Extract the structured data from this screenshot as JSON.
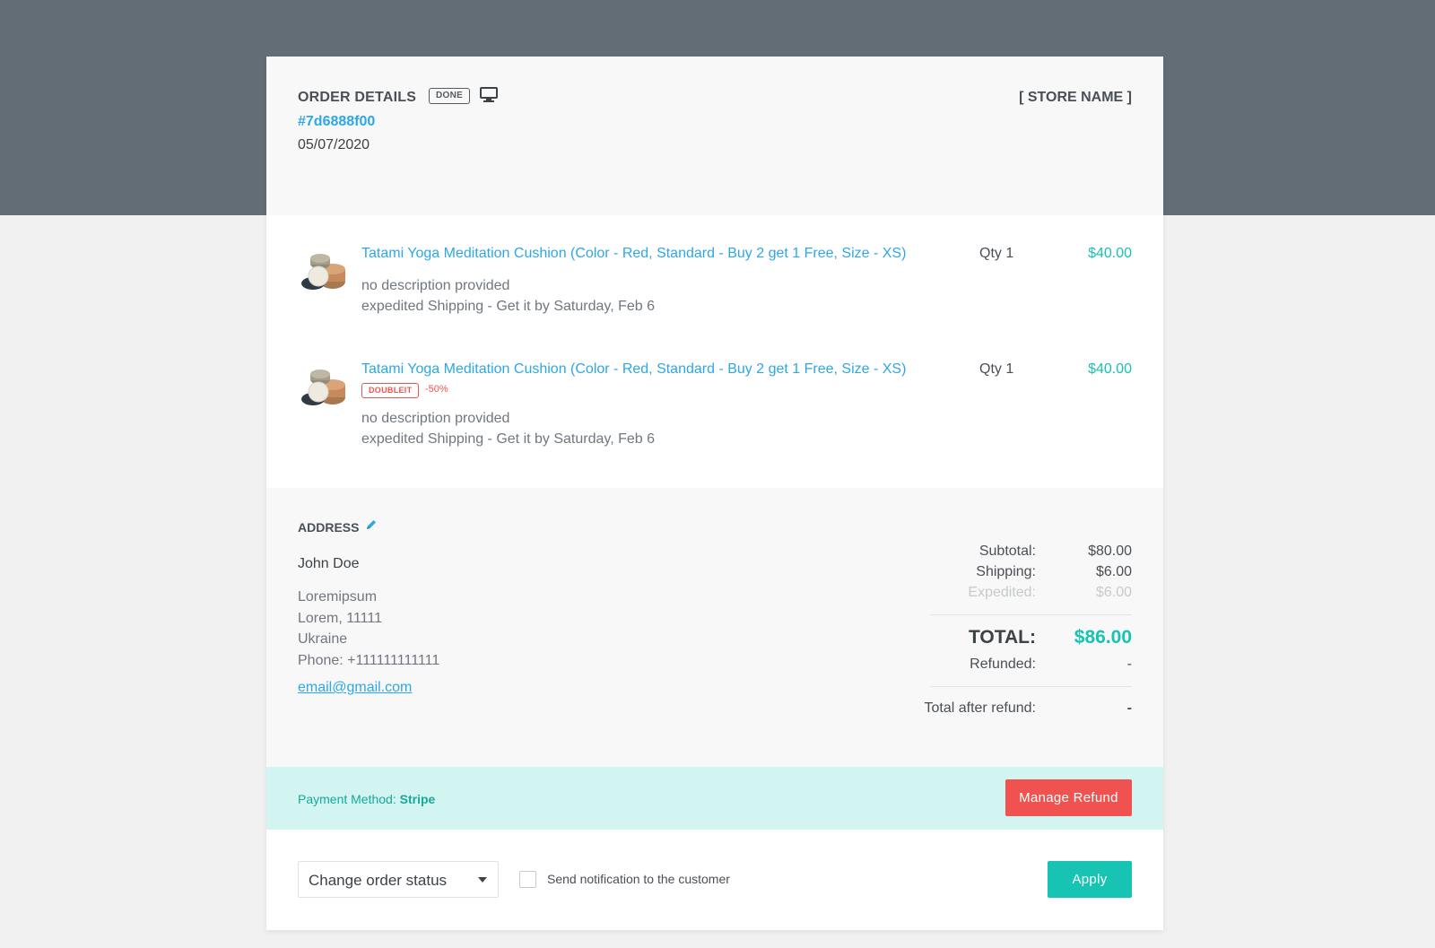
{
  "header": {
    "title": "ORDER DETAILS",
    "status_badge": "DONE",
    "order_id": "#7d6888f00",
    "date": "05/07/2020",
    "store_name": "[ STORE NAME ]"
  },
  "products": [
    {
      "name": "Tatami Yoga Meditation Cushion (Color - Red, Standard - Buy 2 get 1 Free, Size - XS)",
      "qty": "Qty 1",
      "price": "$40.00",
      "description": "no description provided",
      "shipping": "expedited Shipping - Get it by Saturday, Feb 6"
    },
    {
      "name": "Tatami Yoga Meditation Cushion (Color - Red, Standard - Buy 2 get 1 Free, Size - XS)",
      "qty": "Qty 1",
      "price": "$40.00",
      "coupon": "DOUBLEIT",
      "discount": "-50%",
      "description": "no description provided",
      "shipping": "expedited Shipping - Get it by Saturday, Feb 6"
    }
  ],
  "address": {
    "label": "ADDRESS",
    "name": "John Doe",
    "street": "Loremipsum",
    "city": "Lorem, 11111",
    "country": "Ukraine",
    "phone": "Phone: +111111111111",
    "email": "email@gmail.com"
  },
  "totals": {
    "subtotal_label": "Subtotal:",
    "subtotal": "$80.00",
    "shipping_label": "Shipping:",
    "shipping": "$6.00",
    "expedited_label": "Expedited:",
    "expedited": "$6.00",
    "total_label": "TOTAL:",
    "total": "$86.00",
    "refunded_label": "Refunded:",
    "refunded": "-",
    "after_refund_label": "Total after refund:",
    "after_refund": "-"
  },
  "payment": {
    "label": "Payment Method: ",
    "method": "Stripe",
    "refund_button": "Manage Refund"
  },
  "footer": {
    "status_select": "Change order status",
    "notify_label": "Send notification to the customer",
    "apply_button": "Apply"
  },
  "colors": {
    "accent_teal": "#17c3b2",
    "link_blue": "#2ea7e6",
    "danger_red": "#f0524f",
    "header_band": "#636d76"
  },
  "icons": [
    "monitor-icon",
    "cushion-thumbnail",
    "pencil-icon",
    "caret-down-icon",
    "checkbox"
  ]
}
